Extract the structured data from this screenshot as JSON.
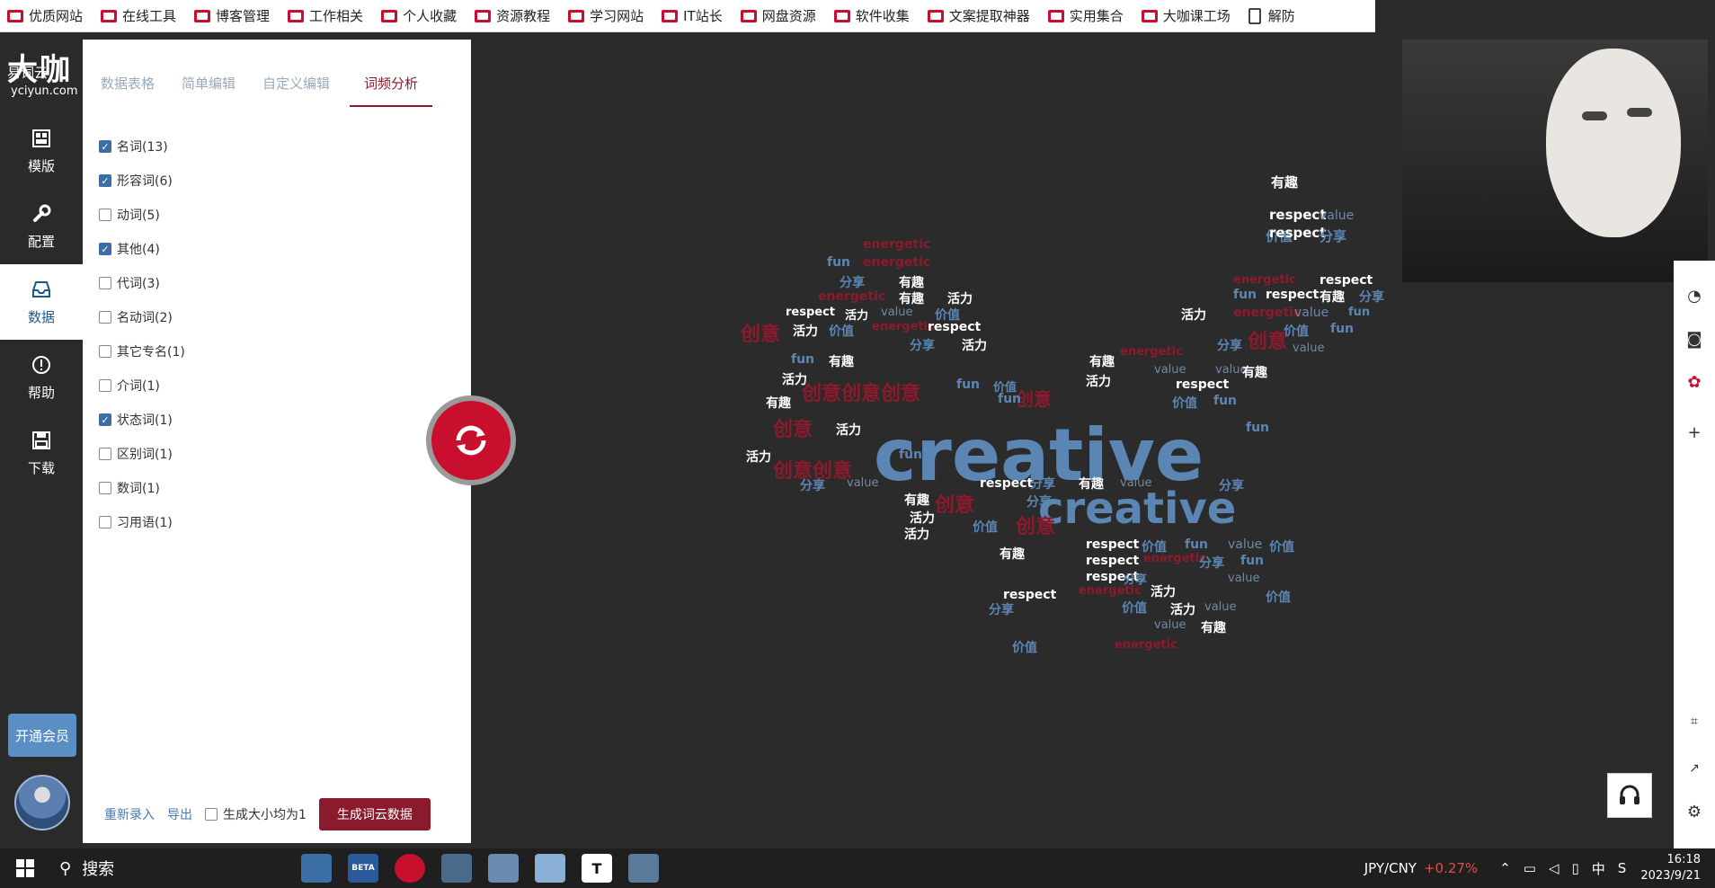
{
  "bookmarks": [
    "优质网站",
    "在线工具",
    "博客管理",
    "工作相关",
    "个人收藏",
    "资源教程",
    "学习网站",
    "IT站长",
    "网盘资源",
    "软件收集",
    "文案提取神器",
    "实用集合",
    "大咖课工场",
    "解防"
  ],
  "logo": {
    "title": "大咖",
    "name": "易词云",
    "url": "yciyun.com"
  },
  "nav": [
    {
      "label": "模版",
      "icon": "template-icon"
    },
    {
      "label": "配置",
      "icon": "wrench-icon"
    },
    {
      "label": "数据",
      "icon": "inbox-icon"
    },
    {
      "label": "帮助",
      "icon": "help-icon"
    },
    {
      "label": "下载",
      "icon": "save-icon"
    }
  ],
  "vip_label": "开通会员",
  "tabs": [
    "数据表格",
    "简单编辑",
    "自定义编辑",
    "词频分析"
  ],
  "checks": [
    {
      "label": "名词(13)",
      "checked": true
    },
    {
      "label": "形容词(6)",
      "checked": true
    },
    {
      "label": "动词(5)",
      "checked": false
    },
    {
      "label": "其他(4)",
      "checked": true
    },
    {
      "label": "代词(3)",
      "checked": false
    },
    {
      "label": "名动词(2)",
      "checked": false
    },
    {
      "label": "其它专名(1)",
      "checked": false
    },
    {
      "label": "介词(1)",
      "checked": false
    },
    {
      "label": "状态词(1)",
      "checked": true
    },
    {
      "label": "区别词(1)",
      "checked": false
    },
    {
      "label": "数词(1)",
      "checked": false
    },
    {
      "label": "习用语(1)",
      "checked": false
    }
  ],
  "bottom": {
    "reenter": "重新录入",
    "export": "导出",
    "uniform": "生成大小均为1",
    "generate": "生成词云数据"
  },
  "colors": {
    "accent": "#8b1a2c",
    "blue_word": "#5b86b4",
    "red_word": "#8b1a2c",
    "white_word": "#ffffff"
  },
  "cloud": {
    "words": [
      {
        "t": "creative",
        "c": "blue"
      },
      {
        "t": "creative",
        "c": "blue"
      },
      {
        "t": "有趣",
        "c": "white"
      },
      {
        "t": "respect",
        "c": "white"
      },
      {
        "t": "value",
        "c": "gray"
      },
      {
        "t": "价值",
        "c": "blue"
      },
      {
        "t": "respect",
        "c": "white"
      },
      {
        "t": "分享",
        "c": "blue"
      },
      {
        "t": "energetic",
        "c": "red"
      },
      {
        "t": "fun",
        "c": "blue"
      },
      {
        "t": "energetic",
        "c": "red"
      },
      {
        "t": "分享",
        "c": "blue"
      },
      {
        "t": "有趣",
        "c": "white"
      },
      {
        "t": "energetic",
        "c": "red"
      },
      {
        "t": "有趣",
        "c": "white"
      },
      {
        "t": "活力",
        "c": "white"
      },
      {
        "t": "energetic",
        "c": "red"
      },
      {
        "t": "respect",
        "c": "white"
      },
      {
        "t": "fun",
        "c": "blue"
      },
      {
        "t": "respect",
        "c": "white"
      },
      {
        "t": "有趣",
        "c": "white"
      },
      {
        "t": "分享",
        "c": "blue"
      },
      {
        "t": "respect",
        "c": "white"
      },
      {
        "t": "活力",
        "c": "white"
      },
      {
        "t": "value",
        "c": "gray"
      },
      {
        "t": "价值",
        "c": "blue"
      },
      {
        "t": "活力",
        "c": "white"
      },
      {
        "t": "energetic",
        "c": "red"
      },
      {
        "t": "value",
        "c": "gray"
      },
      {
        "t": "fun",
        "c": "blue"
      },
      {
        "t": "创意",
        "c": "red"
      },
      {
        "t": "活力",
        "c": "white"
      },
      {
        "t": "价值",
        "c": "blue"
      },
      {
        "t": "energetic",
        "c": "red"
      },
      {
        "t": "respect",
        "c": "white"
      },
      {
        "t": "价值",
        "c": "blue"
      },
      {
        "t": "fun",
        "c": "blue"
      },
      {
        "t": "分享",
        "c": "blue"
      },
      {
        "t": "活力",
        "c": "white"
      },
      {
        "t": "分享",
        "c": "blue"
      },
      {
        "t": "创意",
        "c": "red"
      },
      {
        "t": "value",
        "c": "gray"
      },
      {
        "t": "fun",
        "c": "blue"
      },
      {
        "t": "有趣",
        "c": "white"
      },
      {
        "t": "有趣",
        "c": "white"
      },
      {
        "t": "energetic",
        "c": "red"
      },
      {
        "t": "value",
        "c": "gray"
      },
      {
        "t": "value",
        "c": "gray"
      },
      {
        "t": "有趣",
        "c": "white"
      },
      {
        "t": "活力",
        "c": "white"
      },
      {
        "t": "创意创意创意",
        "c": "red"
      },
      {
        "t": "fun",
        "c": "blue"
      },
      {
        "t": "价值",
        "c": "blue"
      },
      {
        "t": "创意",
        "c": "red"
      },
      {
        "t": "活力",
        "c": "white"
      },
      {
        "t": "respect",
        "c": "white"
      },
      {
        "t": "有趣",
        "c": "white"
      },
      {
        "t": "fun",
        "c": "blue"
      },
      {
        "t": "价值",
        "c": "blue"
      },
      {
        "t": "fun",
        "c": "blue"
      },
      {
        "t": "创意",
        "c": "red"
      },
      {
        "t": "活力",
        "c": "white"
      },
      {
        "t": "fun",
        "c": "blue"
      },
      {
        "t": "活力",
        "c": "white"
      },
      {
        "t": "创意创意",
        "c": "red"
      },
      {
        "t": "fun",
        "c": "blue"
      },
      {
        "t": "分享",
        "c": "blue"
      },
      {
        "t": "value",
        "c": "gray"
      },
      {
        "t": "respect",
        "c": "white"
      },
      {
        "t": "分享",
        "c": "blue"
      },
      {
        "t": "有趣",
        "c": "white"
      },
      {
        "t": "value",
        "c": "gray"
      },
      {
        "t": "分享",
        "c": "blue"
      },
      {
        "t": "有趣",
        "c": "white"
      },
      {
        "t": "创意",
        "c": "red"
      },
      {
        "t": "分享",
        "c": "blue"
      },
      {
        "t": "活力",
        "c": "white"
      },
      {
        "t": "价值",
        "c": "blue"
      },
      {
        "t": "创意",
        "c": "red"
      },
      {
        "t": "活力",
        "c": "white"
      },
      {
        "t": "respect",
        "c": "white"
      },
      {
        "t": "价值",
        "c": "blue"
      },
      {
        "t": "fun",
        "c": "blue"
      },
      {
        "t": "value",
        "c": "gray"
      },
      {
        "t": "价值",
        "c": "blue"
      },
      {
        "t": "有趣",
        "c": "white"
      },
      {
        "t": "respect",
        "c": "white"
      },
      {
        "t": "energetic",
        "c": "red"
      },
      {
        "t": "分享",
        "c": "blue"
      },
      {
        "t": "fun",
        "c": "blue"
      },
      {
        "t": "respect",
        "c": "white"
      },
      {
        "t": "分享",
        "c": "blue"
      },
      {
        "t": "value",
        "c": "gray"
      },
      {
        "t": "respect",
        "c": "white"
      },
      {
        "t": "energetic",
        "c": "red"
      },
      {
        "t": "活力",
        "c": "white"
      },
      {
        "t": "价值",
        "c": "blue"
      },
      {
        "t": "分享",
        "c": "blue"
      },
      {
        "t": "价值",
        "c": "blue"
      },
      {
        "t": "活力",
        "c": "white"
      },
      {
        "t": "value",
        "c": "gray"
      },
      {
        "t": "value",
        "c": "gray"
      },
      {
        "t": "有趣",
        "c": "white"
      },
      {
        "t": "价值",
        "c": "blue"
      },
      {
        "t": "energetic",
        "c": "red"
      }
    ]
  },
  "taskbar": {
    "search": "搜索",
    "apps": [
      "BETA",
      "T"
    ],
    "currency": "JPY/CNY",
    "currency_change": "+0.27%",
    "ime": "中",
    "time": "16:18",
    "date": "2023/9/21"
  }
}
